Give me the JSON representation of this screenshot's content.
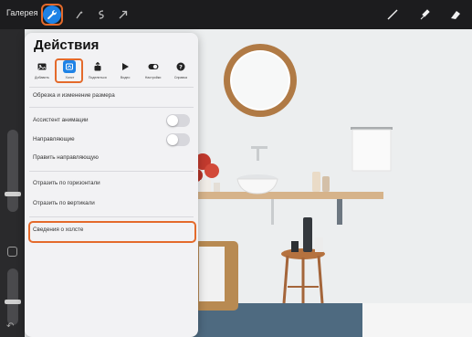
{
  "toolbar": {
    "gallery_label": "Галерея",
    "left_icons": [
      "wrench-icon",
      "magic-wand-icon",
      "selection-icon",
      "transform-arrow-icon"
    ],
    "right_icons": [
      "brush-icon",
      "smudge-icon",
      "eraser-icon"
    ]
  },
  "panel": {
    "title": "Действия",
    "tabs": [
      {
        "label": "Добавить",
        "icon": "image-icon"
      },
      {
        "label": "Холст",
        "icon": "canvas-icon"
      },
      {
        "label": "Поделиться",
        "icon": "share-icon"
      },
      {
        "label": "Видео",
        "icon": "play-icon"
      },
      {
        "label": "Настройки",
        "icon": "toggle-icon"
      },
      {
        "label": "Справка",
        "icon": "help-icon"
      }
    ],
    "selected_tab": "Холст",
    "items": {
      "crop": "Обрезка и изменение размера",
      "animation_assist": "Ассистент анимации",
      "guides": "Направляющие",
      "edit_guides": "Править направляющую",
      "flip_horizontal": "Отразить по горизонтали",
      "flip_vertical": "Отразить по вертикали",
      "canvas_info": "Сведения о холсте"
    },
    "toggles": {
      "animation_assist": false,
      "guides": false
    }
  },
  "colors": {
    "accent": "#1e82e6",
    "highlight": "#e46a2b",
    "toolbar_bg": "#1c1c1e"
  }
}
